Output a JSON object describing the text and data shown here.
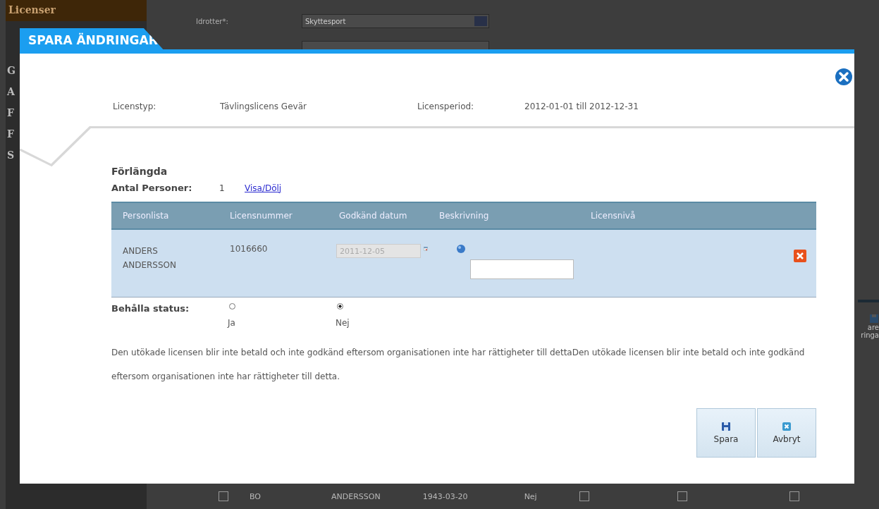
{
  "background": {
    "sidebar_header": "Licenser",
    "sidebar_items": [
      "G",
      "A",
      "F",
      "F",
      "S"
    ],
    "sport_field": {
      "label": "Idrotter*:",
      "value": "Skyttesport"
    },
    "side_button": {
      "lines": [
        "are",
        "ringa"
      ]
    },
    "bottom_row": {
      "cells": [
        "BO",
        "ANDERSSON",
        "1943-03-20",
        "Nej"
      ],
      "checkboxes": [
        {
          "checked": false
        },
        {
          "checked": false
        },
        {
          "checked": false
        },
        {
          "checked": false
        }
      ]
    }
  },
  "dialog": {
    "title": "SPARA ÄNDRINGAR",
    "info": [
      {
        "label": "Licenstyp:",
        "value": "Tävlingslicens Gevär"
      },
      {
        "label": "Licensperiod:",
        "value": "2012-01-01 till 2012-12-31"
      }
    ],
    "section_title": "Förlängda",
    "count_label": "Antal Personer:",
    "count": "1",
    "toggle_link": "Visa/Dölj",
    "table": {
      "columns": [
        "Personlista",
        "Licensnummer",
        "Godkänd datum",
        "Beskrivning",
        "Licensnivå"
      ],
      "rows": [
        {
          "name": "ANDERS ANDERSSON",
          "license_number": "1016660",
          "approved_date": "2011-12-05"
        }
      ]
    },
    "keep_status": {
      "label": "Behålla status:",
      "options": [
        {
          "label": "Ja",
          "selected": false
        },
        {
          "label": "Nej",
          "selected": true
        }
      ]
    },
    "message": "Den utökade licensen blir inte betald och inte godkänd eftersom organisationen inte har rättigheter till dettaDen utökade licensen blir inte betald och inte godkänd eftersom organisationen inte har rättigheter till detta.",
    "buttons": [
      {
        "label": "Spara",
        "kind": "save"
      },
      {
        "label": "Avbryt",
        "kind": "cancel"
      }
    ]
  }
}
